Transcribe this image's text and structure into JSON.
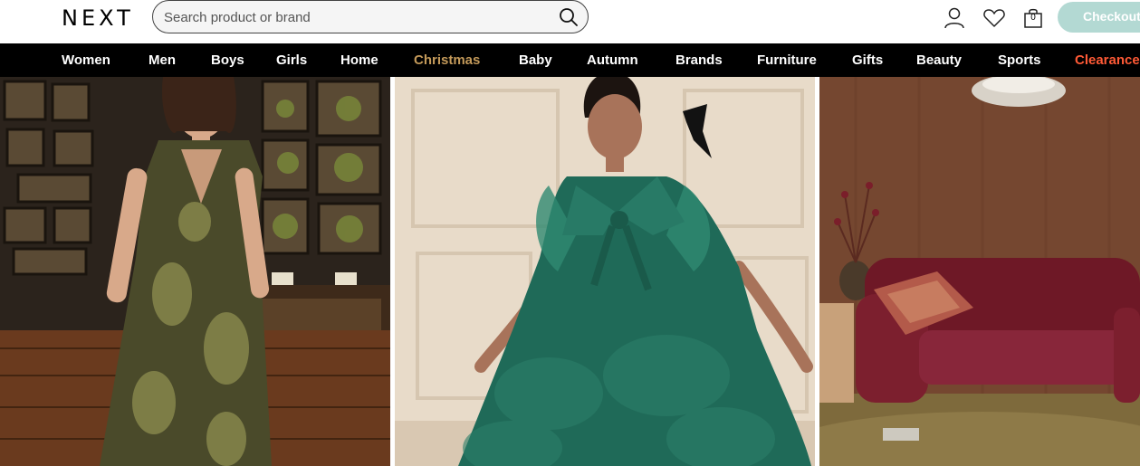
{
  "header": {
    "logo": "NEXT",
    "search_placeholder": "Search product or brand",
    "bag_count": "0",
    "checkout_label": "Checkout"
  },
  "nav": {
    "items": [
      {
        "label": "Women"
      },
      {
        "label": "Men"
      },
      {
        "label": "Boys"
      },
      {
        "label": "Girls"
      },
      {
        "label": "Home"
      },
      {
        "label": "Christmas"
      },
      {
        "label": "Baby"
      },
      {
        "label": "Autumn"
      },
      {
        "label": "Brands"
      },
      {
        "label": "Furniture"
      },
      {
        "label": "Gifts"
      },
      {
        "label": "Beauty"
      },
      {
        "label": "Sports"
      },
      {
        "label": "Clearance"
      }
    ]
  },
  "colors": {
    "nav_background": "#000000",
    "christmas_accent": "#c49a5a",
    "clearance_accent": "#ff5a36",
    "checkout_background": "#b3d9d3"
  },
  "icons": [
    "search-icon",
    "account-icon",
    "heart-icon",
    "bag-icon"
  ],
  "tiles": [
    {
      "name": "women-dress-promo"
    },
    {
      "name": "girls-party-dress-promo"
    },
    {
      "name": "home-sofa-promo"
    }
  ]
}
